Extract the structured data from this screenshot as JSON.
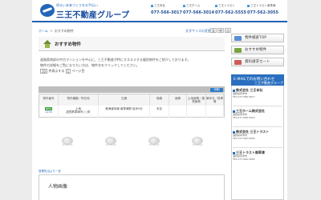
{
  "header": {
    "tagline": "明るい未来づくりをお手伝い",
    "brand": "三王不動産グループ",
    "offices": [
      {
        "name": "三王本社",
        "tel": "077-566-3017"
      },
      {
        "name": "三王ホーム",
        "tel": "077-566-3014"
      },
      {
        "name": "三王トラスト",
        "tel": "077-562-5555"
      },
      {
        "name": "三王トラスト南草津",
        "tel": "077-562-3055"
      }
    ]
  },
  "breadcrumb": {
    "home": "ホーム",
    "sep": ">",
    "current": "おすすめ物件"
  },
  "text_size": {
    "label": "文字サイズの変更",
    "options": [
      "大",
      "中",
      "小"
    ]
  },
  "section": {
    "title": "おすすめ物件",
    "intro": [
      "滋賀県南部の中古マンションを中心に、三王不動産が特にオススメする優良物件をご紹介しております。",
      "物件の詳細をご覧になりたい方は、物件名をクリックしてください。"
    ]
  },
  "controls": {
    "per_page_value": "10",
    "per_page_suffix": "件表示する",
    "page_value": "1",
    "page_suffix": "ページ目"
  },
  "table": {
    "print_label": "印刷",
    "headers": [
      "物件番号",
      "物件種類／所在地",
      "交通",
      "価格",
      "面積",
      "土地面積／建物面積",
      "築年月／駐車場"
    ],
    "row": {
      "id": "1234",
      "badge": "NEW",
      "type": "土地",
      "address": "滋賀県草津市○○町",
      "traffic": "東海道本線 南草津駅 徒歩5分",
      "price": "未定",
      "area": "",
      "land": "",
      "built": ""
    }
  },
  "placeholders": [
    "NO IMAGE",
    "NO IMAGE",
    "NO IMAGE",
    "NO IMAGE"
  ],
  "sub": {
    "label": "営業担当より一言",
    "title": "人物画像"
  },
  "sidebar": {
    "nav": [
      {
        "label": "物件検索TOP",
        "color": "#5a8dd6"
      },
      {
        "label": "おすすめ物件",
        "color": "#7aa241"
      },
      {
        "label": "資料請求カート",
        "color": "#d05a5a"
      }
    ],
    "contact_head": "E-MAILでのお問い合わせ",
    "group_label": "三王不動産グループ",
    "companies": [
      {
        "name": "株式会社 三王本社",
        "lines": [
          "滋賀県草津市",
          "TEL 077-566-3017"
        ]
      },
      {
        "name": "三王ホーム株式会社",
        "lines": [
          "滋賀県草津市",
          "TEL 077-566-3014"
        ]
      },
      {
        "name": "株式会社 三王トラスト",
        "lines": [
          "滋賀県草津市",
          "TEL 077-562-5555"
        ]
      },
      {
        "name": "三王トラスト南草津",
        "lines": [
          "滋賀県草津市",
          "TEL 077-562-3055"
        ]
      }
    ]
  }
}
